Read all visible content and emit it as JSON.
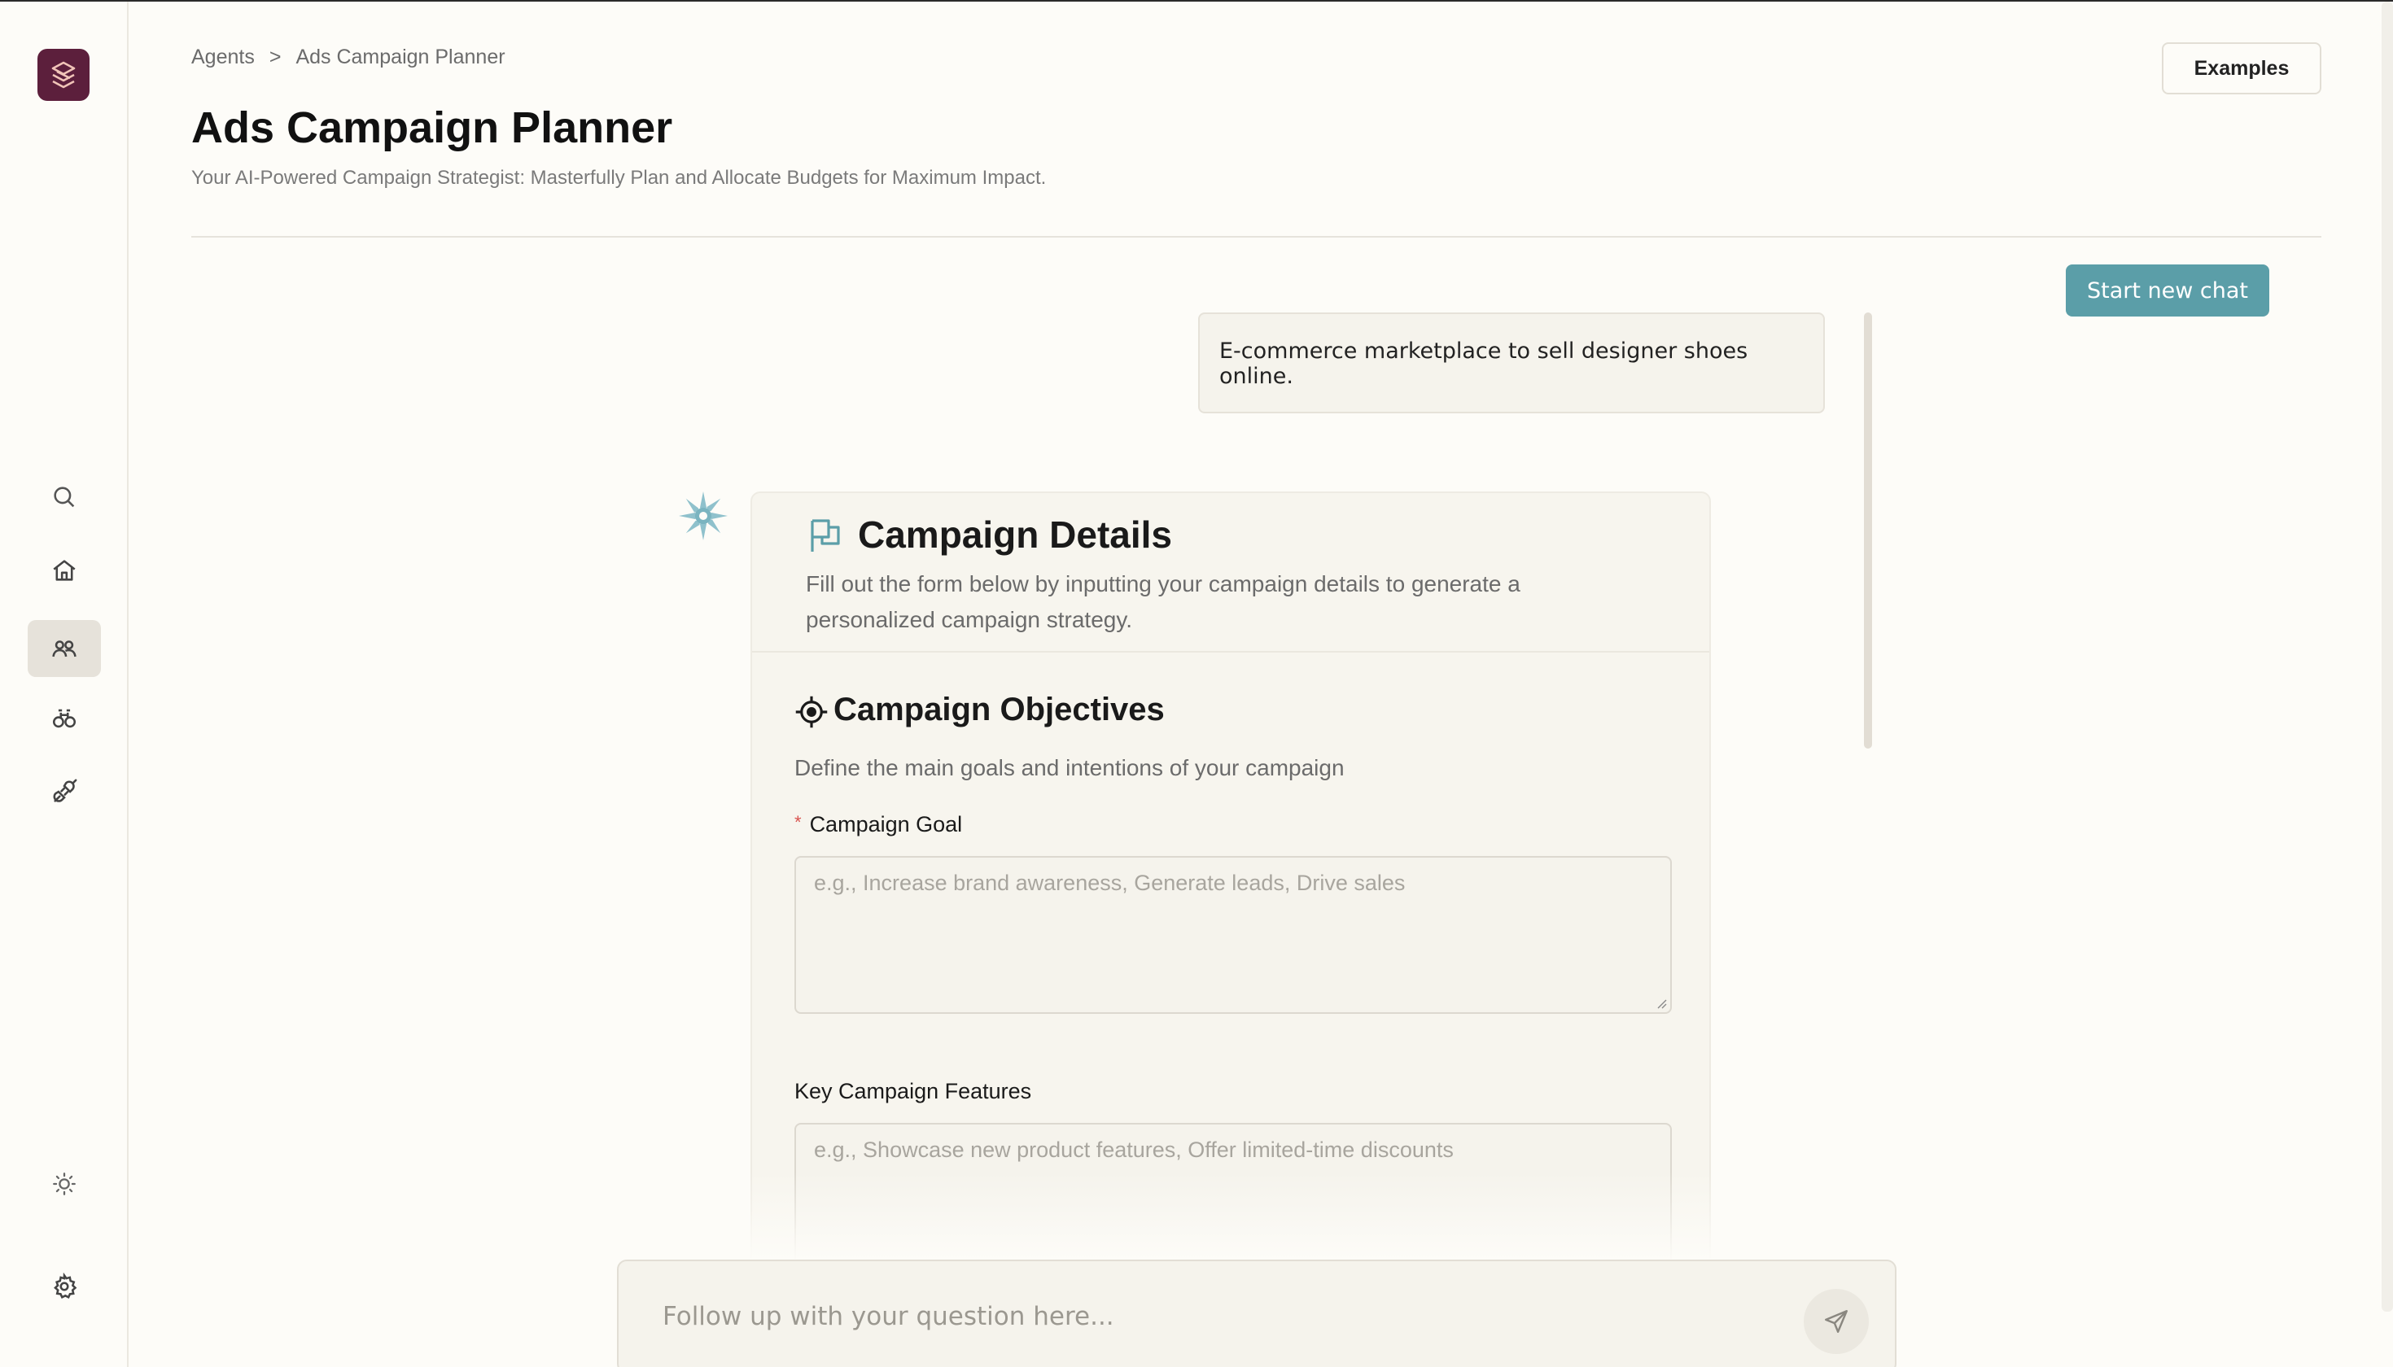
{
  "breadcrumb": {
    "root": "Agents",
    "separator": ">",
    "current": "Ads Campaign Planner"
  },
  "header": {
    "title": "Ads Campaign Planner",
    "subtitle": "Your AI-Powered Campaign Strategist: Masterfully Plan and Allocate Budgets for Maximum Impact.",
    "examples_label": "Examples"
  },
  "chat": {
    "new_chat_label": "Start new chat",
    "user_message": "E-commerce marketplace to sell designer shoes online.",
    "input_placeholder": "Follow up with your question here..."
  },
  "card": {
    "title": "Campaign Details",
    "description": "Fill out the form below by inputting your campaign details to generate a personalized campaign strategy.",
    "section": {
      "title": "Campaign Objectives",
      "description": "Define the main goals and intentions of your campaign"
    },
    "fields": [
      {
        "label": "Campaign Goal",
        "required_mark": "*",
        "placeholder": "e.g., Increase brand awareness, Generate leads, Drive sales"
      },
      {
        "label": "Key Campaign Features",
        "placeholder": "e.g., Showcase new product features, Offer limited-time discounts"
      }
    ]
  },
  "sidebar": {
    "icons": [
      "logo-icon",
      "search-icon",
      "home-icon",
      "agents-icon",
      "binoculars-icon",
      "plug-icon",
      "sun-icon",
      "gear-icon"
    ],
    "active": "agents-icon"
  },
  "colors": {
    "accent": "#5b9ea8",
    "logo_bg": "#5c1f3c",
    "background": "#fdfcf8",
    "required": "#d9534f"
  }
}
